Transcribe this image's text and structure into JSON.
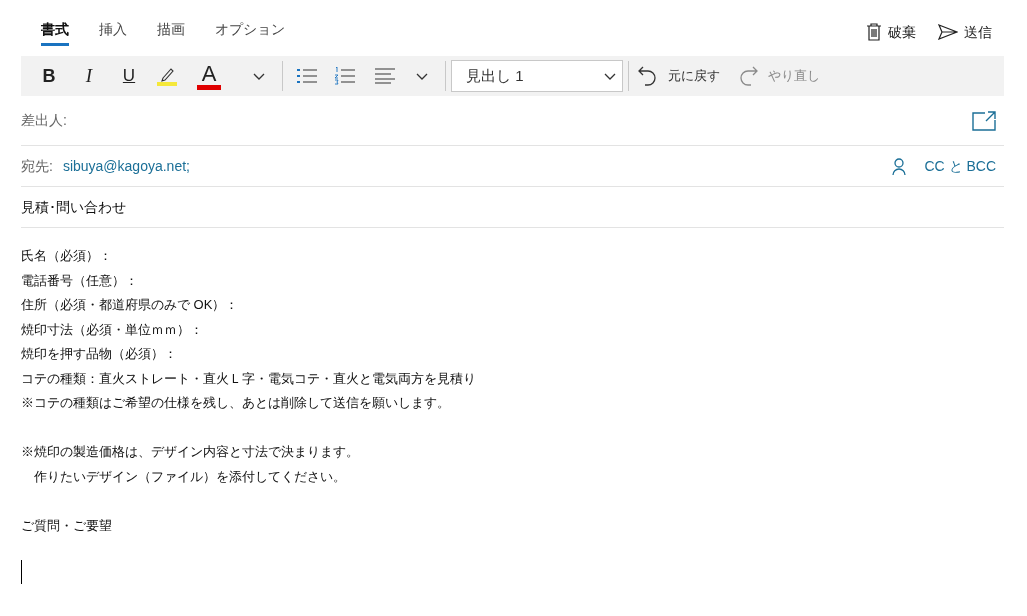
{
  "tabs": [
    {
      "label": "書式",
      "selected": true
    },
    {
      "label": "挿入",
      "selected": false
    },
    {
      "label": "描画",
      "selected": false
    },
    {
      "label": "オプション",
      "selected": false
    }
  ],
  "actions": [
    {
      "kind": "discard",
      "label": "破棄"
    },
    {
      "kind": "send",
      "label": "送信"
    }
  ],
  "toolbar": {
    "bold": "B",
    "italic": "I",
    "underline": "U",
    "font_color": "A",
    "heading": "見出し 1",
    "undo": {
      "label": "元に戻す",
      "disabled": false
    },
    "redo": {
      "label": "やり直し",
      "disabled": true
    }
  },
  "from": {
    "label": "差出人:"
  },
  "to": {
    "label": "宛先:",
    "recipients": [
      "sibuya@kagoya.net;"
    ],
    "cc_bcc": "CC と BCC"
  },
  "subject": "見積･問い合わせ",
  "body": {
    "paragraphs": [
      [
        "氏名（必須）：",
        "電話番号（任意）：",
        "住所（必須・都道府県のみで OK）：",
        "焼印寸法（必須・単位ｍｍ）：",
        "焼印を押す品物（必須）：",
        "コテの種類：直火ストレート・直火Ｌ字・電気コテ・直火と電気両方を見積り",
        "※コテの種類はご希望の仕様を残し、あとは削除して送信を願いします。"
      ],
      [
        "※焼印の製造価格は、デザイン内容と寸法で決まります。",
        "　作りたいデザイン（ファイル）を添付してください。"
      ],
      [
        "ご質問・ご要望"
      ]
    ]
  }
}
